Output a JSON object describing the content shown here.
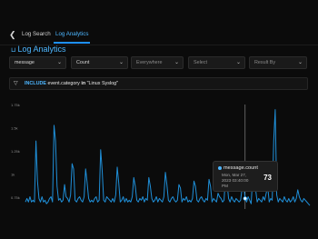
{
  "nav": {
    "tabs": [
      {
        "label": "Log Search",
        "active": false
      },
      {
        "label": "Log Analytics",
        "active": true
      }
    ]
  },
  "page": {
    "title": "Log Analytics"
  },
  "filters": {
    "field": "message",
    "aggregation": "Count",
    "scope_placeholder": "Everywhere",
    "select_placeholder": "Select",
    "group_placeholder": "Result By"
  },
  "query": {
    "keyword": "INCLUDE",
    "field": "event.category",
    "operator": "in",
    "value": "\"Linux Syslog\""
  },
  "tooltip": {
    "series": "message.count",
    "date": "Mon, Mar 27, 2023 03:40:00 PM",
    "value": "73"
  },
  "colors": {
    "accent": "#4db6ff",
    "line": "#1f8fd8",
    "background": "#0b0b0b"
  },
  "chart_data": {
    "type": "line",
    "series": [
      {
        "name": "message.count",
        "values": [
          3,
          5,
          3,
          6,
          3,
          4,
          3,
          38,
          15,
          5,
          3,
          6,
          3,
          4,
          2,
          3,
          5,
          6,
          3,
          47,
          38,
          12,
          4,
          5,
          3,
          4,
          13,
          6,
          5,
          3,
          7,
          25,
          22,
          4,
          3,
          5,
          6,
          4,
          3,
          6,
          22,
          14,
          5,
          3,
          4,
          3,
          5,
          6,
          3,
          4,
          33,
          21,
          4,
          3,
          6,
          5,
          4,
          3,
          5,
          3,
          7,
          23,
          14,
          3,
          4,
          6,
          3,
          5,
          3,
          4,
          3,
          6,
          17,
          12,
          4,
          3,
          5,
          4,
          6,
          3,
          5,
          4,
          17,
          12,
          5,
          3,
          4,
          6,
          3,
          5,
          4,
          3,
          6,
          20,
          13,
          4,
          3,
          5,
          6,
          4,
          3,
          4,
          13,
          11,
          3,
          5,
          4,
          6,
          3,
          4,
          3,
          5,
          15,
          12,
          4,
          3,
          5,
          6,
          4,
          3,
          5,
          4,
          16,
          12,
          3,
          5,
          4,
          3,
          8,
          6,
          5,
          3,
          4,
          18,
          14,
          5,
          3,
          6,
          4,
          3,
          5,
          4,
          3,
          4,
          11,
          14,
          5,
          3,
          6,
          4,
          2,
          17,
          13,
          10,
          3,
          5,
          4,
          3,
          6,
          4,
          8,
          12,
          3,
          5,
          4,
          38,
          56,
          7,
          3,
          5,
          4,
          3,
          6,
          4,
          3,
          5,
          3,
          4,
          6,
          3,
          5,
          10,
          6,
          4,
          3,
          5,
          4,
          3,
          2,
          1
        ]
      }
    ],
    "yticks": [
      "1.75k",
      "1.5k",
      "1.25k",
      "1k",
      "0.75k"
    ],
    "ylim": [
      0,
      60
    ],
    "highlight_index": 146,
    "grid": false
  }
}
